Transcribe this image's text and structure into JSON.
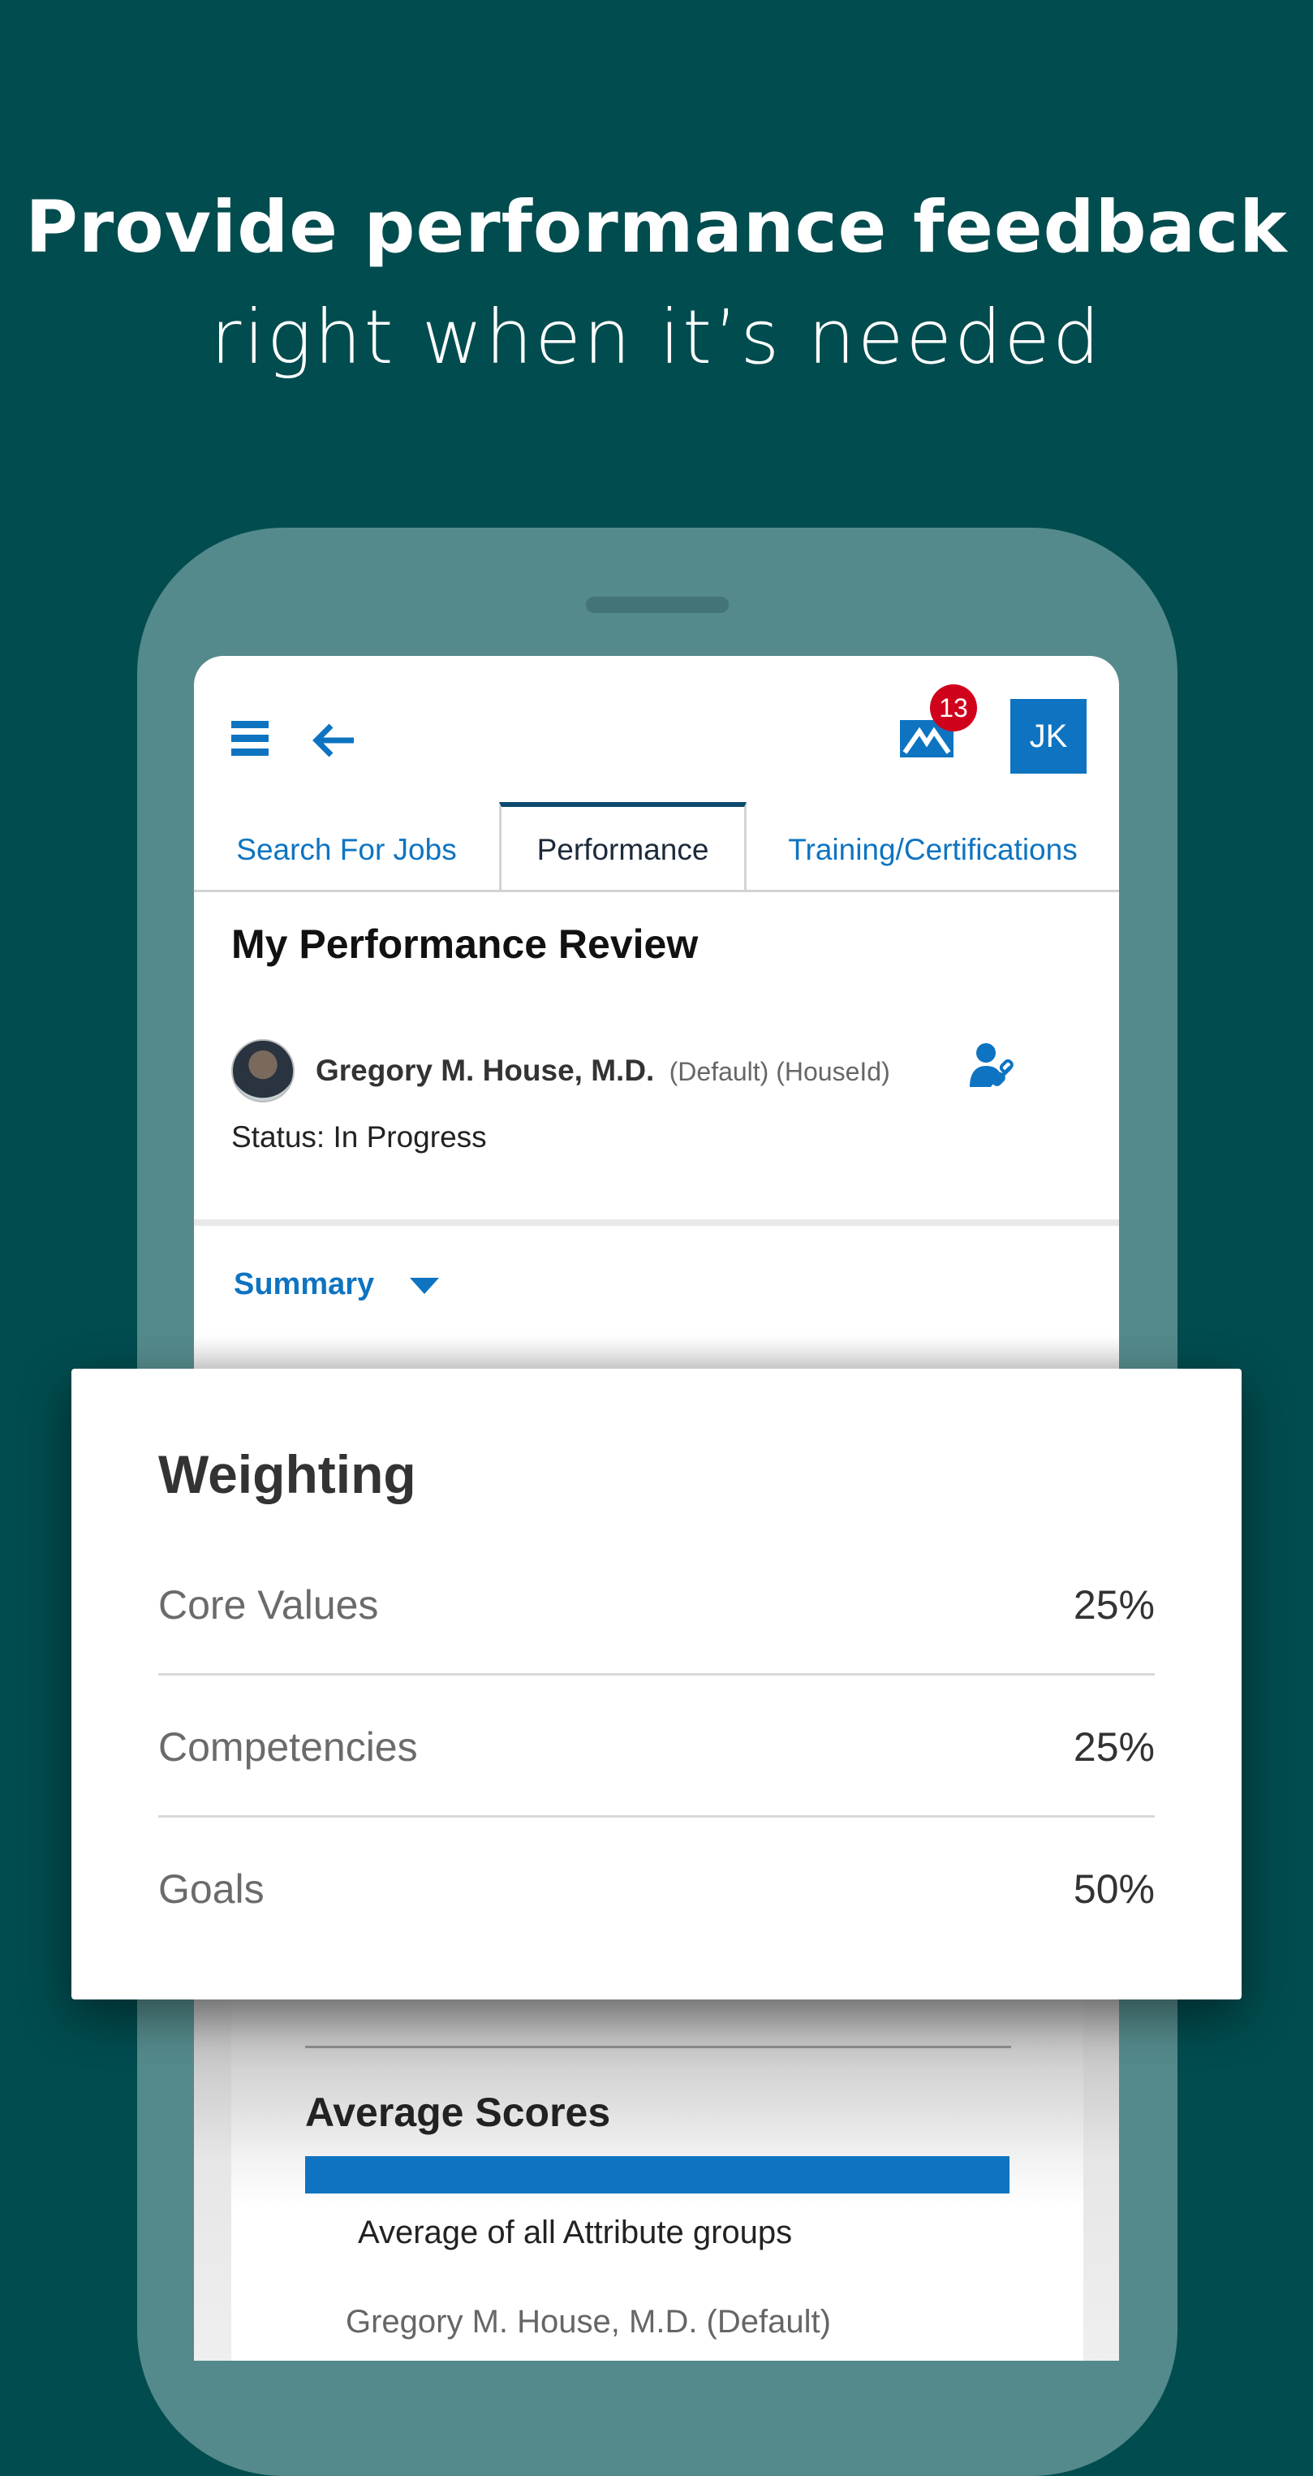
{
  "headline": {
    "line1": "Provide performance feedback",
    "line2": "right when it’s needed"
  },
  "colors": {
    "background": "#014c4f",
    "phone": "#548a8b",
    "accent": "#0e74c1",
    "badge": "#d0021b"
  },
  "header": {
    "menu_icon": "hamburger-icon",
    "back_icon": "arrow-left-icon",
    "mail_icon": "envelope-icon",
    "mail_badge": "13",
    "avatar_initials": "JK"
  },
  "tabs": [
    {
      "label": "Search For Jobs",
      "active": false
    },
    {
      "label": "Performance",
      "active": true
    },
    {
      "label": "Training/Certifications",
      "active": false
    }
  ],
  "review": {
    "title": "My Performance Review",
    "employee_name": "Gregory M. House, M.D.",
    "employee_tags": "(Default) (HouseId)",
    "status": "Status: In Progress",
    "summary_label": "Summary"
  },
  "weighting": {
    "title": "Weighting",
    "rows": [
      {
        "label": "Core Values",
        "value": "25%"
      },
      {
        "label": "Competencies",
        "value": "25%"
      },
      {
        "label": "Goals",
        "value": "50%"
      }
    ]
  },
  "average_scores": {
    "title": "Average Scores",
    "bar_label": "Average of all Attribute groups",
    "employee_row": "Gregory M. House, M.D. (Default)"
  }
}
